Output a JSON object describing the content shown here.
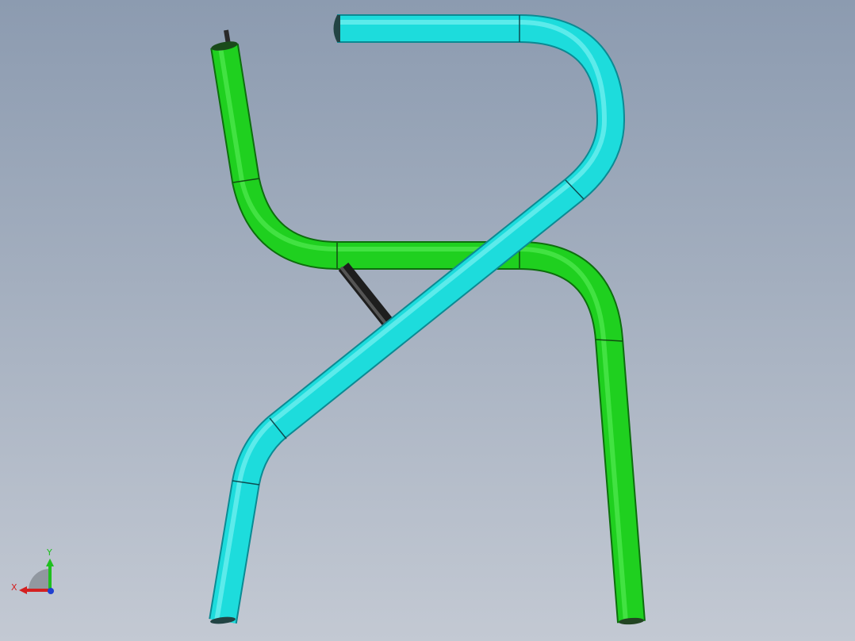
{
  "viewport": {
    "background_top": "#8c9bb0",
    "background_bottom": "#c3c9d3"
  },
  "tubes": {
    "green_color": "#1fcf1f",
    "cyan_color": "#1cdcdc",
    "rod_color": "#333333",
    "seam_color": "#1a3a1a"
  },
  "triad": {
    "x_label": "X",
    "y_label": "Y",
    "x_color": "#d42020",
    "y_color": "#1fbf1f",
    "z_color": "#2040d0"
  }
}
